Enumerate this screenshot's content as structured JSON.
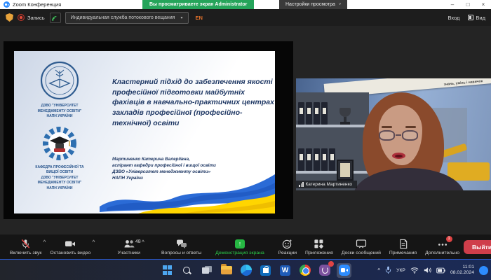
{
  "icons": {
    "minimize": "–",
    "maximize": "□",
    "close": "×",
    "chevron_down": "˅",
    "chevron_up": "^",
    "dropdown_arrow": "▾",
    "share_arrow": "↑",
    "tray_chevron": "^"
  },
  "titlebar": {
    "app_title": "Zoom Конференция",
    "viewing_banner": "Вы просматриваете экран Administrator",
    "view_settings_button": "Настройки просмотра"
  },
  "meetbar": {
    "record_label": "Запись",
    "stream_dropdown": "Индивидуальная служба потокового вещания",
    "language_badge": "EN",
    "signin_label": "Вход",
    "view_label": "Вид"
  },
  "slide": {
    "title": "Кластерний підхід до забезпечення якості професійної підготовки майбутніх фахівців в навчально-практичних центрах закладів професійної (професійно-технічної) освіти",
    "author": "Мартиненко Катерина Валеріївна,\nаспірант кафедри професійної і вищої освіти\nДЗВО «Університет менеджменту освіти»\nНАПН України",
    "logo1_caption": "ДЗВО \"УНІВЕРСИТЕТ\nМЕНЕДЖМЕНТУ ОСВІТИ\"\nНАПН УКРАЇНИ",
    "logo2_caption": "КАФЕДРА ПРОФЕСІЙНОЇ ТА\nВИЩОЇ ОСВІТИ\nДЗВО \"УНІВЕРСИТЕТ\nМЕНЕДЖМЕНТУ ОСВІТИ\"\nНАПН УКРАЇНИ"
  },
  "video": {
    "participant_name": "Катерина Мартиненко",
    "banner_text": "знань, умінь і навичок"
  },
  "toolbar": {
    "buttons": [
      {
        "label": "Включить звук"
      },
      {
        "label": "Остановить видео"
      },
      {
        "label": "Участники",
        "count": "48"
      },
      {
        "label": "Вопросы и ответы"
      },
      {
        "label": "Демонстрация экрана"
      },
      {
        "label": "Реакции"
      },
      {
        "label": "Приложения"
      },
      {
        "label": "Доски сообщений"
      },
      {
        "label": "Примечания"
      },
      {
        "label": "Дополнительно",
        "badge": "1"
      }
    ],
    "leave_button": "Выйти"
  },
  "taskbar": {
    "language": "УКР",
    "time": "11:01",
    "date": "08.02.2024",
    "word_letter": "W"
  },
  "colors": {
    "zoom_green": "#25a45a",
    "share_green": "#26b843",
    "leave_red": "#cf3e4a",
    "accent_orange": "#e0702a",
    "slide_navy": "#1f3864",
    "flag_blue": "#2b6bd6",
    "flag_yellow": "#ffd500"
  }
}
